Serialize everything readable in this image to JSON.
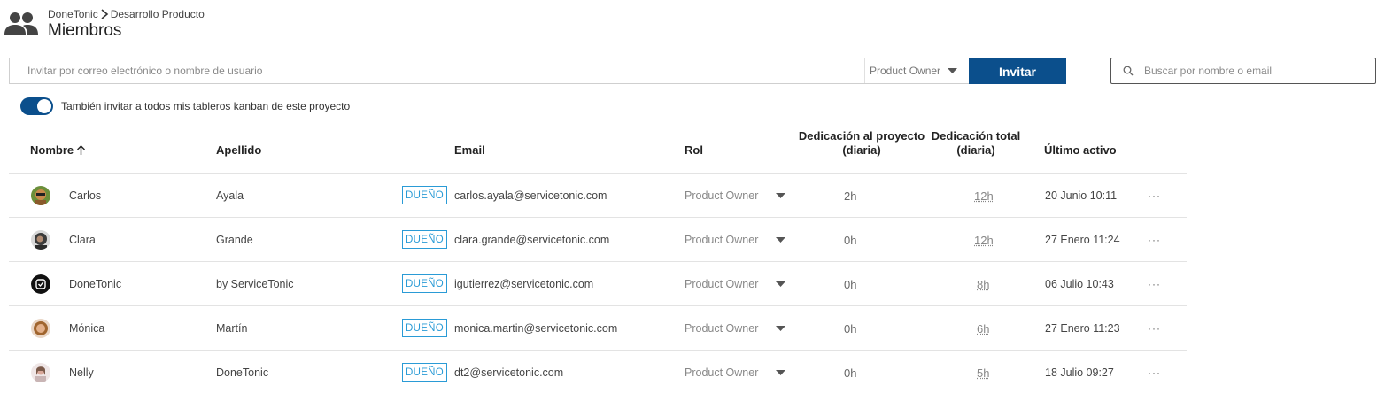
{
  "header": {
    "icon": "users-icon",
    "breadcrumb": {
      "root": "DoneTonic",
      "current": "Desarrollo Producto"
    },
    "title": "Miembros"
  },
  "invite": {
    "placeholder": "Invitar por correo electrónico o nombre de usuario",
    "role": "Product Owner",
    "button": "Invitar"
  },
  "search": {
    "placeholder": "Buscar por nombre o email"
  },
  "toggle": {
    "on": true,
    "label": "También invitar a todos mis tableros kanban de este proyecto"
  },
  "table": {
    "columns": {
      "name": "Nombre",
      "surname": "Apellido",
      "email": "Email",
      "role": "Rol",
      "dedication_line1": "Dedicación al proyecto",
      "dedication_line2": "(diaria)",
      "total_line1": "Dedicación total",
      "total_line2": "(diaria)",
      "last_active": "Último activo"
    },
    "badge_label": "DUEÑO",
    "more_label": "···",
    "rows": [
      {
        "name": "Carlos",
        "surname": "Ayala",
        "email": "carlos.ayala@servicetonic.com",
        "role": "Product Owner",
        "dedication": "2h",
        "total": "12h",
        "last_active": "20 Junio 10:11",
        "avatar_color": "#c98a4b"
      },
      {
        "name": "Clara",
        "surname": "Grande",
        "email": "clara.grande@servicetonic.com",
        "role": "Product Owner",
        "dedication": "0h",
        "total": "12h",
        "last_active": "27 Enero 11:24",
        "avatar_color": "#3b3b3b"
      },
      {
        "name": "DoneTonic",
        "surname": "by ServiceTonic",
        "email": "igutierrez@servicetonic.com",
        "role": "Product Owner",
        "dedication": "0h",
        "total": "8h",
        "last_active": "06 Julio 10:43",
        "avatar_color": "#111111"
      },
      {
        "name": "Mónica",
        "surname": "Martín",
        "email": "monica.martin@servicetonic.com",
        "role": "Product Owner",
        "dedication": "0h",
        "total": "6h",
        "last_active": "27 Enero 11:23",
        "avatar_color": "#d9a26a"
      },
      {
        "name": "Nelly",
        "surname": "DoneTonic",
        "email": "dt2@servicetonic.com",
        "role": "Product Owner",
        "dedication": "0h",
        "total": "5h",
        "last_active": "18 Julio 09:27",
        "avatar_color": "#e7c9c0"
      }
    ]
  },
  "colors": {
    "primary": "#0b4f8c",
    "badge": "#2a9bd6"
  }
}
